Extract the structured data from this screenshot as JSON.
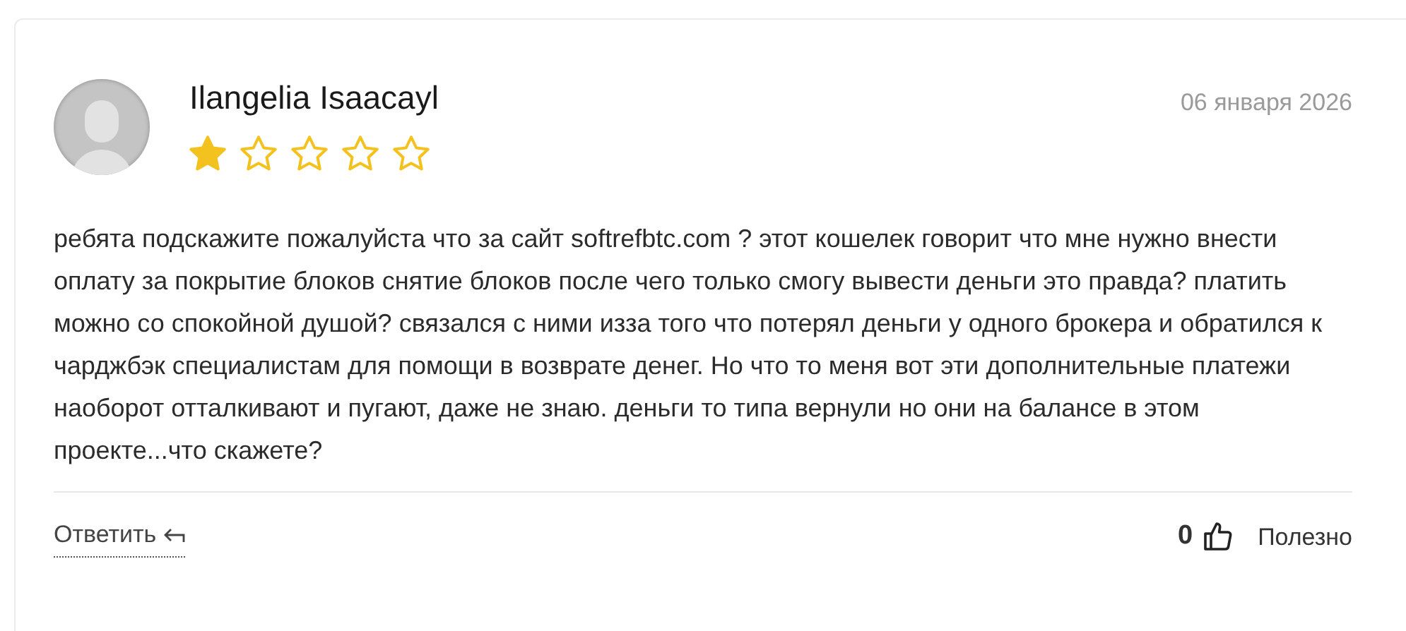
{
  "review": {
    "author": "Ilangelia Isaacayl",
    "date": "06 января 2026",
    "stars": 1,
    "text": "ребята подскажите пожалуйста что за сайт softrefbtc.com ? этот кошелек говорит что мне нужно внести оплату за покрытие блоков снятие блоков после чего только смогу вывести деньги это правда? платить можно со спокойной душой? связался с ними изза того что потерял деньги у одного брокера и обратился к чарджбэк специалистам для помощи в возврате денег. Но что то меня вот эти дополнительные платежи наоборот отталкивают и пугают, даже не знаю. деньги то типа вернули но они на балансе в этом проекте...что скажете?",
    "reply_label": "Ответить",
    "likes": "0",
    "helpful_label": "Полезно"
  }
}
